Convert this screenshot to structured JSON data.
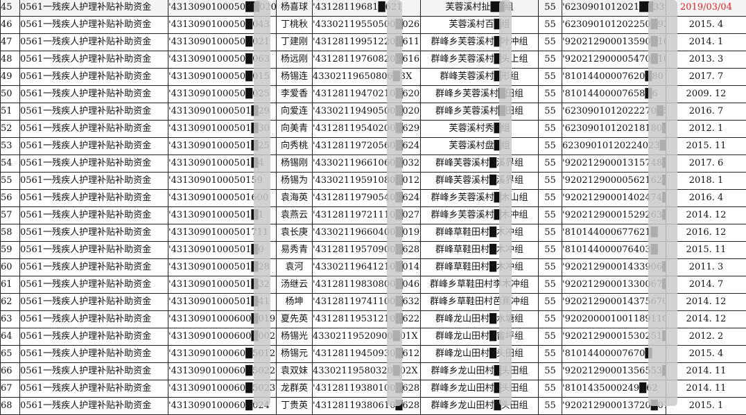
{
  "sheet": {
    "rows": [
      {
        "idx": "45",
        "fund": "0561一残疾人护理补贴补助资金",
        "acct": "'4313090100050██020",
        "name": "杨喜球",
        "id": "'43128119681█621",
        "addr": "芙蓉溪村扯██组",
        "amt": "55",
        "card": "'6230901012021██3390",
        "date": "2019/03/04",
        "highlight": true
      },
      {
        "idx": "46",
        "fund": "0561一残疾人护理补贴补助资金",
        "acct": "'4313090100050█043",
        "name": "丁桃秋",
        "id": "'43302119550500█026",
        "addr": "芙蓉溪村百█组",
        "amt": "55",
        "card": "'623090101202250█925",
        "date": "2015. 4"
      },
      {
        "idx": "47",
        "fund": "0561一残疾人护理补贴补助资金",
        "acct": "'4313090100050█021",
        "name": "丁建刚",
        "id": "'43128119951220█611",
        "addr": "群峰乡芙蓉溪村█叶冲组",
        "amt": "55",
        "card": "'920212900013590█1011",
        "date": "2014. 1"
      },
      {
        "idx": "48",
        "fund": "0561一残疾人护理补贴补助资金",
        "acct": "'4313090100050█063",
        "name": "杨远刚",
        "id": "'43128119760820█616",
        "addr": "群峰乡芙蓉溪村█头上组",
        "amt": "55",
        "card": "'920212900005470█1011",
        "date": "2013. 3"
      },
      {
        "idx": "49",
        "fund": "0561一残疾人护理补贴补助资金",
        "acct": "'4313090100050█015",
        "name": "杨锡连",
        "id": "43302119650806█3X",
        "addr": "群峰芙蓉溪村█形组",
        "amt": "55",
        "card": "'81014400007620█80",
        "date": "2017. 7"
      },
      {
        "idx": "50",
        "fund": "0561一残疾人护理补贴补助资金",
        "acct": "'4313090100050█025",
        "name": "李爱香",
        "id": "'43128119470210█620",
        "addr": "群峰乡芙蓉溪村█田组",
        "amt": "55",
        "card": "'81014400007658█6",
        "date": "2009. 12"
      },
      {
        "idx": "51",
        "fund": "0561一残疾人护理补贴补助资金",
        "acct": "'43130901000501█29",
        "name": "向爱连",
        "id": "'43302119490500█020",
        "addr": "群峰乡芙蓉溪村█田组",
        "amt": "55",
        "card": "'6230901012022270█5",
        "date": "2016. 7"
      },
      {
        "idx": "52",
        "fund": "0561一残疾人护理补贴补助资金",
        "acct": "'43130901000501█30",
        "name": "向美青",
        "id": "'43128119540200█629",
        "addr": "芙蓉溪村秀█组",
        "amt": "55",
        "card": "'62309010120218180█1",
        "date": "2012. 1"
      },
      {
        "idx": "53",
        "fund": "0561一残疾人护理补贴补助资金",
        "acct": "'43130901000501█25",
        "name": "向秀桃",
        "id": "'43128119720560█624",
        "addr": "芙蓉溪村盘█组",
        "amt": "55",
        "card": "62309010120224023█",
        "date": "2015. 11"
      },
      {
        "idx": "54",
        "fund": "0561一残疾人护理补贴补助资金",
        "acct": "'43130901000501█4",
        "name": "杨锡刚",
        "id": "'43302119661060█032",
        "addr": "群峰芙蓉溪村█溪界组",
        "amt": "55",
        "card": "'92021290001315748█1",
        "date": "2017. 6"
      },
      {
        "idx": "55",
        "fund": "0561一残疾人护理补贴补助资金",
        "acct": "'4313090100050159",
        "name": "杨锡为",
        "id": "'43302119591080█012",
        "addr": "群峰芙蓉溪村█溪界组",
        "amt": "55",
        "card": "'92021290000562162█1",
        "date": "2018. 1"
      },
      {
        "idx": "56",
        "fund": "0561一残疾人护理补贴补助资金",
        "acct": "'43130901000501600",
        "name": "袁海英",
        "id": "'43128119790540█624",
        "addr": "群峰乡芙蓉溪村█木山组",
        "amt": "55",
        "card": "'92021290001402474█1",
        "date": "2016. 4"
      },
      {
        "idx": "57",
        "fund": "0561一残疾人护理补贴补助资金",
        "acct": "'43130901000501█1",
        "name": "袁燕云",
        "id": "'43128119721110█027",
        "addr": "群峰乡芙蓉溪村█木冲组",
        "amt": "55",
        "card": "'92021290001529263█1",
        "date": "2014. 12"
      },
      {
        "idx": "58",
        "fund": "0561一残疾人护理补贴补助资金",
        "acct": "'43130901000501711",
        "name": "袁长庚",
        "id": "'43302119660400█019",
        "addr": "群峰草鞋田村█木冲组",
        "amt": "55",
        "card": "'810144000677621█",
        "date": "2016. 12"
      },
      {
        "idx": "59",
        "fund": "0561一残疾人护理补贴补助资金",
        "acct": "'43130901000501█0",
        "name": "易秀青",
        "id": "'43128119570900█628",
        "addr": "群峰草鞋田村█木冲组",
        "amt": "55",
        "card": "'810144000076403█",
        "date": "2015. 11"
      },
      {
        "idx": "60",
        "fund": "0561一残疾人护理补贴补助资金",
        "acct": "'43130901000501█28",
        "name": "袁河",
        "id": "'43302119641210█014",
        "addr": "群峰草鞋田村█木冲组",
        "amt": "55",
        "card": "'92021290001433906█1",
        "date": "2011. 3"
      },
      {
        "idx": "61",
        "fund": "0561一残疾人护理补贴补助资金",
        "acct": "'43130901000501█32",
        "name": "汤继云",
        "id": "'43128119830800█046",
        "addr": "群峰乡草鞋田村李木冲组",
        "amt": "55",
        "card": "'92021290001330067█1",
        "date": "2014. 7"
      },
      {
        "idx": "62",
        "fund": "0561一残疾人护理补贴补助资金",
        "acct": "'43130901000501█41",
        "name": "杨坤",
        "id": "'43128119741100█632",
        "addr": "群峰乡草鞋田村芭蕉冲组",
        "amt": "55",
        "card": "'920212900014375670█11",
        "date": "2014. 12"
      },
      {
        "idx": "63",
        "fund": "0561一残疾人护理补贴补助资金",
        "acct": "'43130901000600█019",
        "name": "夏先英",
        "id": "'43128119531210█622",
        "addr": "群峰龙山田村█水塘组",
        "amt": "55",
        "card": "'920200001001189110█11",
        "date": "2014. 12"
      },
      {
        "idx": "64",
        "fund": "0561一残疾人护理补贴补助资金",
        "acct": "'43130901000600█002",
        "name": "杨锡光",
        "id": "43302119520900█01X",
        "addr": "群峰龙山田村█畲坪组",
        "amt": "55",
        "card": "'92021290001530251█11",
        "date": "2012. 2"
      },
      {
        "idx": "65",
        "fund": "0561一残疾人护理补贴补助资金",
        "acct": "'4313090100060█5012",
        "name": "杨锡元",
        "id": "'43128119450930█612",
        "addr": "群峰龙山田村█头田组",
        "amt": "55",
        "card": "'81014400007670█",
        "date": "2015. 4"
      },
      {
        "idx": "66",
        "fund": "0561一残疾人护理补贴补助资金",
        "acct": "'4313090100060█5022",
        "name": "袁双妹",
        "id": "43302119580320█02X",
        "addr": "群峰乡龙山田村█头田组",
        "amt": "55",
        "card": "'92021290001356553█11",
        "date": "2014. 11"
      },
      {
        "idx": "67",
        "fund": "0561一残疾人护理补贴补助资金",
        "acct": "'4313090100060█5023",
        "name": "龙群英",
        "id": "'43128119380100█628",
        "addr": "群峰乡龙山田村█头田组",
        "amt": "55",
        "card": "'8101435000249█62",
        "date": "2014. 11"
      },
      {
        "idx": "68",
        "fund": "0561一残疾人护理补贴补助资金",
        "acct": "'4313090100060█024",
        "name": "丁贵英",
        "id": "'43128119380610█628",
        "addr": "群峰乡龙山田村█头田组",
        "amt": "55",
        "card": "'920212900013720█011",
        "date": "2015. 1"
      }
    ]
  }
}
